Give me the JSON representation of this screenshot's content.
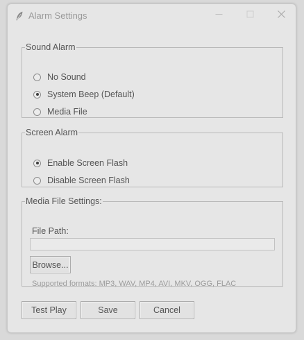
{
  "window": {
    "title": "Alarm Settings",
    "icons": {
      "app": "feather-icon",
      "minimize": "minimize-icon",
      "maximize": "maximize-icon",
      "close": "close-icon"
    }
  },
  "sound_alarm": {
    "legend": "Sound Alarm",
    "options": [
      {
        "label": "No Sound",
        "selected": false
      },
      {
        "label": "System Beep (Default)",
        "selected": true
      },
      {
        "label": "Media File",
        "selected": false
      }
    ]
  },
  "screen_alarm": {
    "legend": "Screen Alarm",
    "options": [
      {
        "label": "Enable Screen Flash",
        "selected": true
      },
      {
        "label": "Disable Screen Flash",
        "selected": false
      }
    ]
  },
  "media_settings": {
    "legend": "Media File Settings:",
    "file_path_label": "File Path:",
    "file_path_value": "",
    "browse_label": "Browse...",
    "supported_formats": "Supported formats: MP3, WAV, MP4, AVI, MKV, OGG, FLAC"
  },
  "actions": {
    "test_play": "Test Play",
    "save": "Save",
    "cancel": "Cancel"
  },
  "colors": {
    "window_bg": "#e6e6e6",
    "text": "#555555",
    "muted_text": "#9b9b9b",
    "border": "#b9b9b9"
  }
}
